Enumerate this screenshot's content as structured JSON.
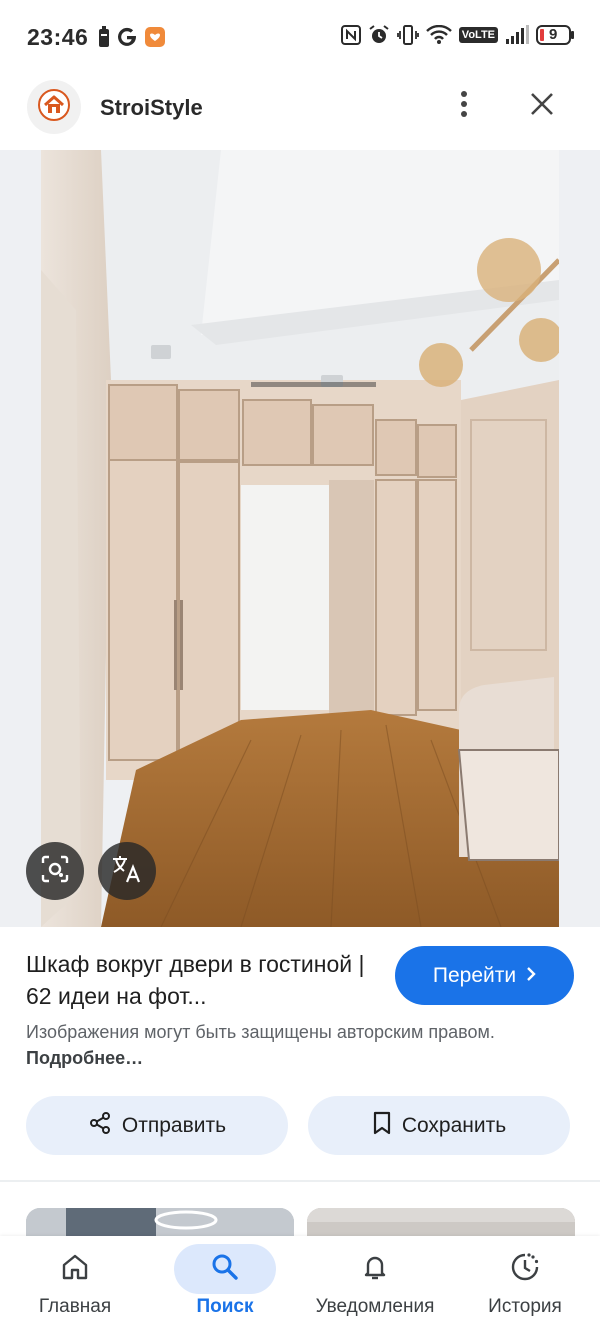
{
  "status_bar": {
    "time": "23:46",
    "left_icons": [
      "battery-saver-icon",
      "google-icon",
      "app-notification-icon"
    ],
    "right_icons": [
      "nfc-icon",
      "alarm-icon",
      "vibrate-icon",
      "wifi-icon",
      "volte-icon",
      "signal-icon",
      "battery-icon"
    ],
    "volte_label": "VoLTE",
    "battery_level": "9"
  },
  "header": {
    "site_name": "StroiStyle",
    "logo_icon": "house-icon",
    "logo_color": "#d9581f"
  },
  "image": {
    "alt": "",
    "lens_icon": "lens-icon",
    "translate_icon": "translate-icon"
  },
  "result": {
    "title": "Шкаф вокруг двери в гостиной | 62 идеи на фот...",
    "visit_label": "Перейти",
    "copyright_text": "Изображения могут быть защищены авторским правом.",
    "more_link": "Подробнее…"
  },
  "actions": {
    "share_label": "Отправить",
    "save_label": "Сохранить"
  },
  "bottom_nav": {
    "items": [
      {
        "label": "Главная",
        "icon": "home-icon",
        "active": false
      },
      {
        "label": "Поиск",
        "icon": "search-icon",
        "active": true
      },
      {
        "label": "Уведомления",
        "icon": "bell-icon",
        "active": false
      },
      {
        "label": "История",
        "icon": "history-icon",
        "active": false
      }
    ]
  },
  "colors": {
    "accent": "#1a73e8",
    "pill_bg": "#e8effa",
    "active_nav_bg": "#dce8fc"
  }
}
